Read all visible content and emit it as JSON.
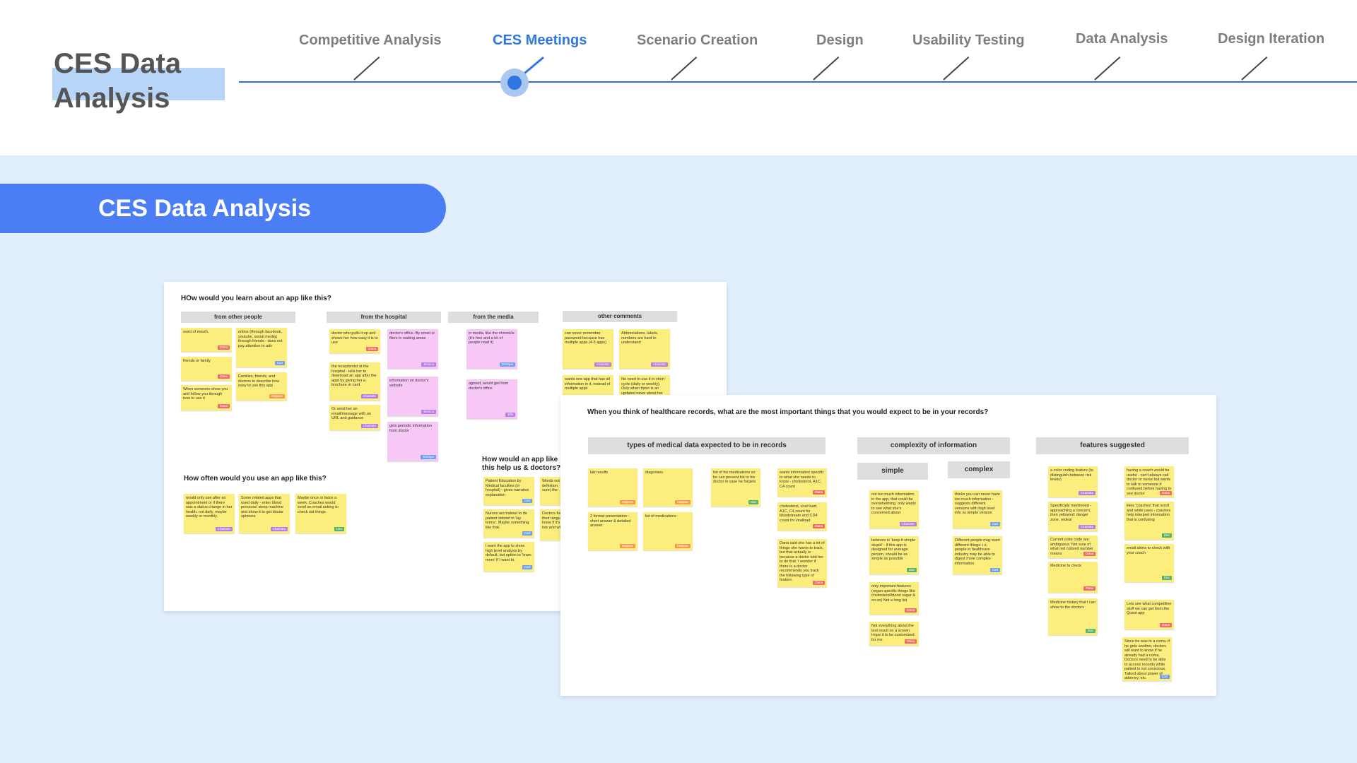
{
  "header": {
    "title": "CES Data Analysis",
    "steps": [
      {
        "label": "Competitive Analysis"
      },
      {
        "label": "CES Meetings"
      },
      {
        "label": "Scenario Creation"
      },
      {
        "label": "Design"
      },
      {
        "label": "Usability Testing"
      },
      {
        "label": "Data Analysis"
      },
      {
        "label": "Design Iteration"
      }
    ],
    "active_step": "CES Meetings"
  },
  "banner": {
    "title": "CES Data Analysis"
  },
  "colors": {
    "accent": "#2f77e0",
    "banner": "#4b7ef5",
    "background": "#e1eefb",
    "highlight": "#b6d5f7",
    "sticky_yellow": "#fbee7c",
    "sticky_pink": "#f7c8f5"
  },
  "board1": {
    "question1": "HOw would you learn about an app like this?",
    "columns": [
      "from other people",
      "from the hospital",
      "from the media",
      "other comments"
    ],
    "notes": [
      {
        "text": "word of mouth.",
        "tag": "Dana"
      },
      {
        "text": "online (through facebook, youtube, social media) through friends - does not pay attention to ads",
        "tag": "Carl"
      },
      {
        "text": "friends or family",
        "tag": "Dana"
      },
      {
        "text": "Families, friends, and doctors to describe how easy to use this app",
        "tag": "Halijean"
      },
      {
        "text": "When someone show you and follow you through how to use it",
        "tag": "Dana"
      },
      {
        "text": "doctor who pulls it up and shows her how easy it is to use",
        "tag": "Dana"
      },
      {
        "text": "doctor's office. By email or fliers in waiting areas",
        "tag": "Monica"
      },
      {
        "text": "the receptionist at the hospital - tells her to download an app after the appt by giving her a brochure or card",
        "tag": "Charlotte"
      },
      {
        "text": "information on doctor's website",
        "tag": "Monica"
      },
      {
        "text": "Or send her an email/message with an URL and guidance",
        "tag": "Charlotte"
      },
      {
        "text": "gets periodic information from doctor",
        "tag": "Enrique"
      },
      {
        "text": "in media, like the chronicle (it's free and a lot of people read it)",
        "tag": "Enrique"
      },
      {
        "text": "agreed, would get from doctor's office",
        "tag": "Ella"
      },
      {
        "text": "can never remember password because has multiple apps (4-5 apps)",
        "tag": "Charlotte"
      },
      {
        "text": "Abbreviations, labels, numbers are hard to understand",
        "tag": "Charlotte"
      },
      {
        "text": "wants one app that has all information in it, instead of multiple apps",
        "tag": ""
      },
      {
        "text": "No need to use it in short cycle (daily or weekly). Only when there is an updated news about her",
        "tag": ""
      }
    ],
    "question2": "How often would you use an app like this?",
    "notes2": [
      {
        "text": "would only use after an appointment or if there was a status change in her health. not daily, maybe weekly or monthly.",
        "tag": "Charlotte"
      },
      {
        "text": "Some related apps that used daily - enter blood pressure/ sleep machine and show it to get doctor opinions",
        "tag": "Charlotte"
      },
      {
        "text": "Maybe once or twice a week. Coaches would send an email asking to check out things",
        "tag": "Dan"
      }
    ],
    "question3": "How would an app like this help us & doctors?",
    "notes3": [
      {
        "text": "Patient Education by Medical faculties (in hospital) - gives narrative explanation",
        "tag": "Carl"
      },
      {
        "text": "Words not definition sure) the",
        "tag": ""
      },
      {
        "text": "Nurses are trained to do patient debrief in 'lay terms'. Maybe something like that.",
        "tag": "Carl"
      },
      {
        "text": "Doctors for their langua know if it's low and wh",
        "tag": ""
      },
      {
        "text": "I want the app to show high level analysis by default, but option to 'learn more' if I want to.",
        "tag": "Carl"
      }
    ]
  },
  "board2": {
    "question": "When you think of healthcare records, what are the most important things that you would expect to be in your records?",
    "columns": [
      "types of medical data expected to be in records",
      "complexity of information",
      "features suggested"
    ],
    "subcolumns": [
      "simple",
      "complex"
    ],
    "notes": [
      {
        "text": "lab results",
        "tag": "Halijean"
      },
      {
        "text": "diagnoses",
        "tag": "Halijean"
      },
      {
        "text": "list of his medications so he can present list to his doctor in case he forgets",
        "tag": "Dan"
      },
      {
        "text": "wants information specific to what she needs to know - cholesterol, A1C, C4 count",
        "tag": "Dana"
      },
      {
        "text": "2 format presentation - short answer & detailed answer",
        "tag": "Halijean"
      },
      {
        "text": "list of medications",
        "tag": "Halijean"
      },
      {
        "text": "cholesterol, viral load, A1C, C4 count for bloodstream and CD4 count for viralload",
        "tag": "Dana"
      },
      {
        "text": "Dana said she has a lot of things she wants to track, but that actually is because a doctor told her to do that. I wonder if there is a doctor recommends you track the following type of feature.",
        "tag": "Dana"
      },
      {
        "text": "not too much information in the app, that could be overwhelming. only wants to see what she's concerned about",
        "tag": "Charlotte"
      },
      {
        "text": "thinks you can never have too much information - suggests different versions with high level info vs simple version",
        "tag": "Carl"
      },
      {
        "text": "believes in 'keep it simple stupid' - if this app is designed for average person, should be as simple as possible",
        "tag": "Dan"
      },
      {
        "text": "Different people may want different things: i.e. people in healthcare industry may be able to digest more complex information",
        "tag": "Carl"
      },
      {
        "text": "only important features (organ specific things like cholesterol/blood sugar & so on) Not a long list",
        "tag": "Dana"
      },
      {
        "text": "Not everything about the test result on a screen. Hope it to be customized for me",
        "tag": "Dana"
      },
      {
        "text": "a color coding feature (to distinguish between risk levels)",
        "tag": "Charlotte"
      },
      {
        "text": "having a coach would be useful - can't always call doctor or nurse but wants to talk to someone if confused before having to see doctor",
        "tag": "Dana"
      },
      {
        "text": "Specifically mentioned - approaching a concern, then yellowed: danger zone, redeal",
        "tag": "Charlotte"
      },
      {
        "text": "likes 'coaches' that scroll and white uses - coaches help interpret information that is confusing",
        "tag": "Dan"
      },
      {
        "text": "Current color code are ambiguous. Not sure of what red colored number means",
        "tag": "Dana"
      },
      {
        "text": "email alerts to check with your coach",
        "tag": "Dan"
      },
      {
        "text": "Medicine to check",
        "tag": "Dana"
      },
      {
        "text": "Medicine history that I can show to the doctors",
        "tag": "Dan"
      },
      {
        "text": "Lets see what competitive stuff we can get from the Quest app",
        "tag": "Dana"
      },
      {
        "text": "Since he was in a coma, if he gets another, doctors will want to know if he already had a coma. Doctors need to be able to access records while patient is not conscious. Talked about power of attorney, etc.",
        "tag": "Carl"
      }
    ]
  }
}
